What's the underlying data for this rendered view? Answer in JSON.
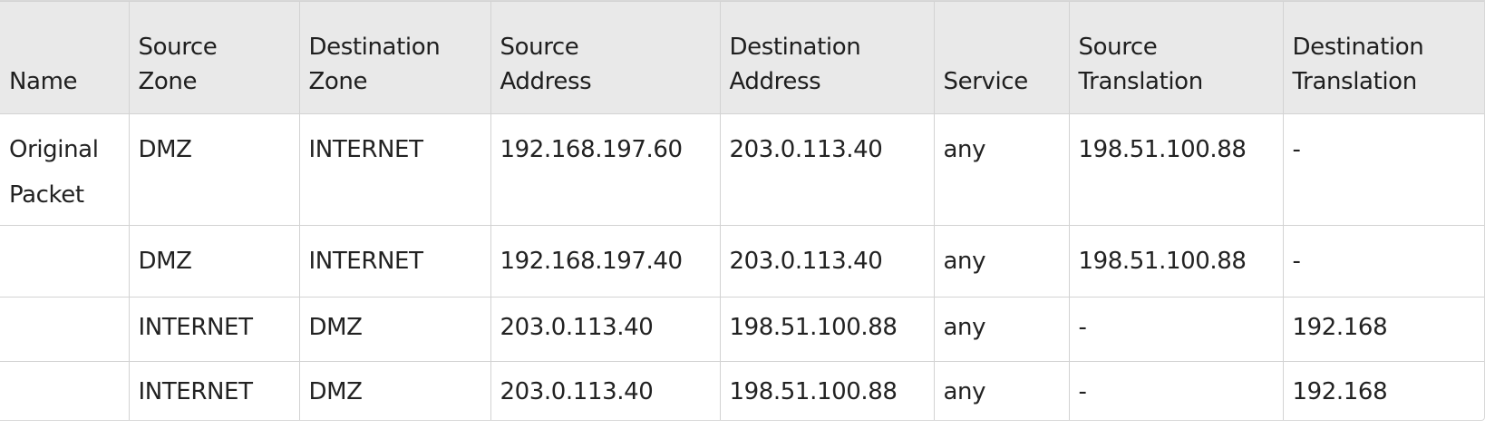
{
  "table": {
    "columns": [
      {
        "line1": "Name",
        "line2": ""
      },
      {
        "line1": "Source",
        "line2": "Zone"
      },
      {
        "line1": "Destination",
        "line2": "Zone"
      },
      {
        "line1": "Source",
        "line2": "Address"
      },
      {
        "line1": "Destination",
        "line2": "Address"
      },
      {
        "line1": "Service",
        "line2": ""
      },
      {
        "line1": "Source",
        "line2": "Translation"
      },
      {
        "line1": "Destination",
        "line2": "Translation"
      }
    ],
    "rows": [
      [
        "Original Packet",
        "DMZ",
        "INTERNET",
        "192.168.197.60",
        "203.0.113.40",
        "any",
        "198.51.100.88",
        "-"
      ],
      [
        "",
        "DMZ",
        "INTERNET",
        "192.168.197.40",
        "203.0.113.40",
        "any",
        "198.51.100.88",
        "-"
      ],
      [
        "",
        "INTERNET",
        "DMZ",
        "203.0.113.40",
        "198.51.100.88",
        "any",
        "-",
        "192.168"
      ],
      [
        "",
        "INTERNET",
        "DMZ",
        "203.0.113.40",
        "198.51.100.88",
        "any",
        "-",
        "192.168"
      ]
    ]
  }
}
